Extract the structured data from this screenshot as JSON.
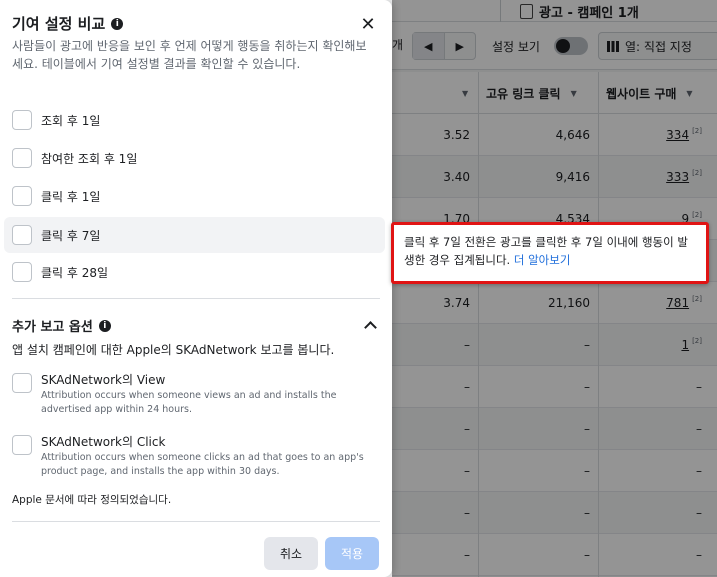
{
  "background": {
    "campaign_label": "광고 - 캠페인 1개",
    "toolbar": {
      "partial_text": "개",
      "prev_label": "◀",
      "next_label": "▶",
      "setting_view_label": "설정 보기",
      "columns_label": "열: 직접 지정"
    },
    "columns": [
      "고유 링크 클릭",
      "웹사이트 구매"
    ],
    "rows": [
      {
        "c1": "3.52",
        "c2": "4,646",
        "c3": "334",
        "c3_link": true
      },
      {
        "c1": "3.40",
        "c2": "9,416",
        "c3": "333",
        "c3_link": true
      },
      {
        "c1": "1.70",
        "c2": "4,534",
        "c3": "9",
        "c3_link": true
      },
      {
        "c1": "",
        "c2": "",
        "c3": "",
        "c3_link": false
      },
      {
        "c1": "3.74",
        "c2": "21,160",
        "c3": "781",
        "c3_link": true
      },
      {
        "c1": "–",
        "c2": "–",
        "c3": "1",
        "c3_link": true
      },
      {
        "c1": "–",
        "c2": "–",
        "c3": "–",
        "c3_link": false
      },
      {
        "c1": "–",
        "c2": "–",
        "c3": "–",
        "c3_link": false
      },
      {
        "c1": "–",
        "c2": "–",
        "c3": "–",
        "c3_link": false
      },
      {
        "c1": "–",
        "c2": "–",
        "c3": "–",
        "c3_link": false
      },
      {
        "c1": "–",
        "c2": "–",
        "c3": "–",
        "c3_link": false
      }
    ],
    "footnote_mark": "[2]"
  },
  "panel": {
    "title": "기여 설정 비교",
    "close_label": "✕",
    "description": "사람들이 광고에 반응을 보인 후 언제 어떻게 행동을 취하는지 확인해보세요. 테이블에서 기여 설정별 결과를 확인할 수 있습니다.",
    "options": [
      {
        "label": "조회 후 1일"
      },
      {
        "label": "참여한 조회 후 1일"
      },
      {
        "label": "클릭 후 1일"
      },
      {
        "label": "클릭 후 7일"
      },
      {
        "label": "클릭 후 28일"
      }
    ],
    "additional": {
      "title": "추가 보고 옵션",
      "description": "앱 설치 캠페인에 대한 Apple의 SKAdNetwork 보고를 봅니다.",
      "items": [
        {
          "title": "SKAdNetwork의 View",
          "desc": "Attribution occurs when someone views an ad and installs the advertised app within 24 hours."
        },
        {
          "title": "SKAdNetwork의 Click",
          "desc": "Attribution occurs when someone clicks an ad that goes to an app's product page, and installs the app within 30 days."
        }
      ],
      "note": "Apple 문서에 따라 정의되었습니다."
    },
    "buttons": {
      "cancel": "취소",
      "apply": "적용"
    }
  },
  "tooltip": {
    "text": "클릭 후 7일 전환은 광고를 클릭한 후 7일 이내에 행동이 발생한 경우 집계됩니다.",
    "link": "더 알아보기"
  },
  "colors": {
    "highlight_border": "#e01414",
    "link": "#216fdb",
    "apply_disabled": "#a7c7f7"
  }
}
